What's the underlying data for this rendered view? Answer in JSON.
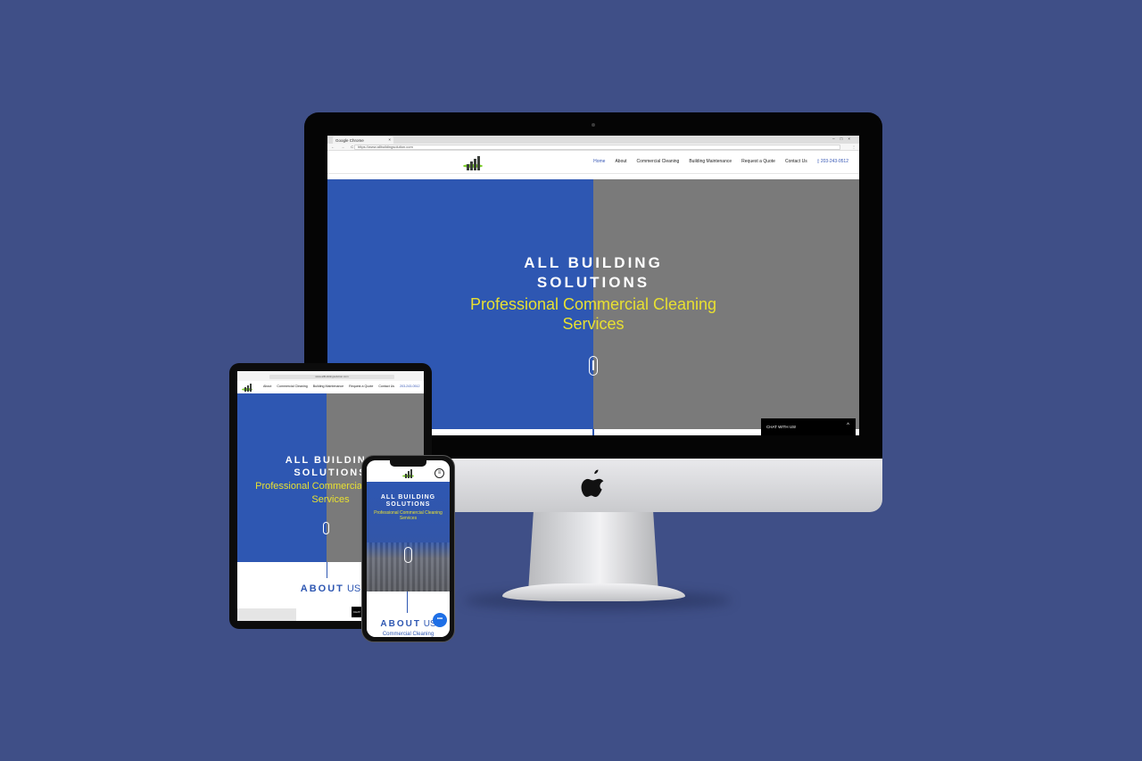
{
  "site": {
    "name_line1": "ALL BUILDING",
    "name_line2": "SOLUTIONS",
    "tagline_line1": "Professional Commercial Cleaning",
    "tagline_line2": "Services",
    "tagline_single": "Professional Commercial Cleaning Services",
    "about_word": "ABOUT",
    "about_us": "US",
    "about_sub": "Commercial Cleaning"
  },
  "browser": {
    "tab_title": "Google Chrome",
    "tab_close": "×",
    "window_controls": "–□×",
    "nav_arrows": "← → C",
    "url": "https://www.allbuildingsolution.com",
    "menu": "⋮"
  },
  "nav": {
    "items": [
      "Home",
      "About",
      "Commercial Cleaning",
      "Building Maintenance",
      "Request a Quote",
      "Contact Us"
    ],
    "phone": "203-243-0512"
  },
  "tablet_nav": {
    "items": [
      "About",
      "Commercial Cleaning",
      "Building Maintenance",
      "Request a Quote",
      "Contact Us"
    ],
    "phone": "203-243-0512",
    "url": "www.allbuildingsolution.com"
  },
  "chat": {
    "label": "CHAT WITH US!",
    "caret": "^",
    "tablet_label": "CHAT"
  },
  "phone_ui": {
    "menu_icon": "≡",
    "fab_icon": "•••"
  },
  "colors": {
    "background": "#3f4f87",
    "brand_blue": "#2e57b2",
    "hero_gray": "#7a7a7a",
    "tagline_yellow": "#e8e031"
  }
}
